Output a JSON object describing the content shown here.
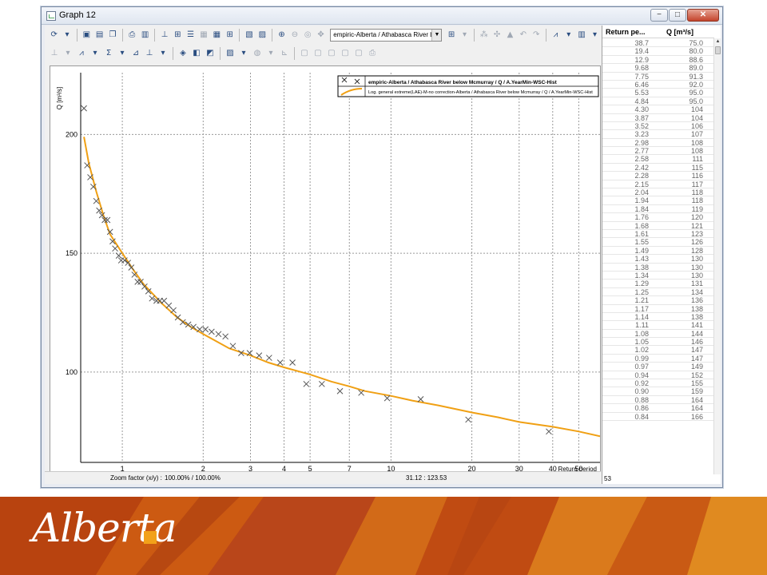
{
  "window": {
    "title": "Graph 12",
    "minimize_label": "−",
    "maximize_label": "□",
    "close_label": "✕"
  },
  "toolbar": {
    "series_combo_value": "empiric-Alberta / Athabasca River belo"
  },
  "legend": {
    "entries": [
      "empiric-Alberta / Athabasca River below Mcmurray / Q / A.YearMin-WSC-Hist",
      "Log. general extreme(LAE)-M-no correction-Alberta / Athabasca River below Mcmurray / Q / A.YearMin-WSC-Hist"
    ]
  },
  "status": {
    "zoom_label": "Zoom factor (x/y) :",
    "zoom_value": "100.00% / 100.00%",
    "coordinates": "31.12 : 123.53"
  },
  "table": {
    "col_return_period": "Return pe...",
    "col_q": "Q [m³/s]",
    "rows": [
      [
        "38.7",
        "75.0"
      ],
      [
        "19.4",
        "80.0"
      ],
      [
        "12.9",
        "88.6"
      ],
      [
        "9.68",
        "89.0"
      ],
      [
        "7.75",
        "91.3"
      ],
      [
        "6.46",
        "92.0"
      ],
      [
        "5.53",
        "95.0"
      ],
      [
        "4.84",
        "95.0"
      ],
      [
        "4.30",
        "104"
      ],
      [
        "3.87",
        "104"
      ],
      [
        "3.52",
        "106"
      ],
      [
        "3.23",
        "107"
      ],
      [
        "2.98",
        "108"
      ],
      [
        "2.77",
        "108"
      ],
      [
        "2.58",
        "111"
      ],
      [
        "2.42",
        "115"
      ],
      [
        "2.28",
        "116"
      ],
      [
        "2.15",
        "117"
      ],
      [
        "2.04",
        "118"
      ],
      [
        "1.94",
        "118"
      ],
      [
        "1.84",
        "119"
      ],
      [
        "1.76",
        "120"
      ],
      [
        "1.68",
        "121"
      ],
      [
        "1.61",
        "123"
      ],
      [
        "1.55",
        "126"
      ],
      [
        "1.49",
        "128"
      ],
      [
        "1.43",
        "130"
      ],
      [
        "1.38",
        "130"
      ],
      [
        "1.34",
        "130"
      ],
      [
        "1.29",
        "131"
      ],
      [
        "1.25",
        "134"
      ],
      [
        "1.21",
        "136"
      ],
      [
        "1.17",
        "138"
      ],
      [
        "1.14",
        "138"
      ],
      [
        "1.11",
        "141"
      ],
      [
        "1.08",
        "144"
      ],
      [
        "1.05",
        "146"
      ],
      [
        "1.02",
        "147"
      ],
      [
        "0.99",
        "147"
      ],
      [
        "0.97",
        "149"
      ],
      [
        "0.94",
        "152"
      ],
      [
        "0.92",
        "155"
      ],
      [
        "0.90",
        "159"
      ],
      [
        "0.88",
        "164"
      ],
      [
        "0.86",
        "164"
      ],
      [
        "0.84",
        "166"
      ]
    ],
    "row_count": "53"
  },
  "chart_data": {
    "type": "scatter",
    "xscale": "log",
    "ylabel": "Q [m³/s]",
    "xlabel": "Return period",
    "xlim": [
      0.7,
      60
    ],
    "ylim": [
      62,
      226
    ],
    "grid": true,
    "legend_position": "top-right",
    "x_ticks": [
      1,
      2,
      3,
      4,
      5,
      7,
      10,
      20,
      30,
      40,
      50
    ],
    "y_ticks": [
      100,
      150,
      200
    ],
    "empirical": {
      "x": [
        38.7,
        19.4,
        12.9,
        9.68,
        7.75,
        6.46,
        5.53,
        4.84,
        4.3,
        3.87,
        3.52,
        3.23,
        2.98,
        2.77,
        2.58,
        2.42,
        2.28,
        2.15,
        2.04,
        1.94,
        1.84,
        1.76,
        1.68,
        1.61,
        1.55,
        1.49,
        1.43,
        1.38,
        1.34,
        1.29,
        1.25,
        1.21,
        1.17,
        1.14,
        1.11,
        1.08,
        1.05,
        1.02,
        0.99,
        0.97,
        0.94,
        0.92,
        0.9,
        0.88,
        0.86,
        0.84,
        0.82,
        0.8,
        0.78,
        0.76,
        0.74,
        0.72
      ],
      "y": [
        75.0,
        80.0,
        88.6,
        89.0,
        91.3,
        92.0,
        95.0,
        95.0,
        104,
        104,
        106,
        107,
        108,
        108,
        111,
        115,
        116,
        117,
        118,
        118,
        119,
        120,
        121,
        123,
        126,
        128,
        130,
        130,
        130,
        131,
        134,
        136,
        138,
        138,
        141,
        144,
        146,
        147,
        147,
        149,
        152,
        155,
        159,
        164,
        164,
        166,
        168,
        172,
        178,
        182,
        187,
        211
      ],
      "color": "#555555",
      "marker": "x"
    },
    "fitted": {
      "x": [
        0.72,
        0.75,
        0.8,
        0.85,
        0.9,
        1.0,
        1.1,
        1.2,
        1.4,
        1.6,
        1.8,
        2.0,
        2.5,
        3.0,
        3.5,
        4.0,
        5.0,
        6.0,
        7.0,
        8.0,
        10,
        12,
        15,
        20,
        25,
        30,
        40,
        50,
        60
      ],
      "y": [
        199,
        188,
        176,
        166,
        158,
        150,
        143,
        137,
        129,
        123,
        119,
        116,
        110,
        107,
        104,
        102,
        99,
        96,
        94,
        92,
        90,
        88,
        86,
        83,
        81,
        79,
        77,
        75,
        73
      ],
      "color": "#f0a014"
    }
  }
}
